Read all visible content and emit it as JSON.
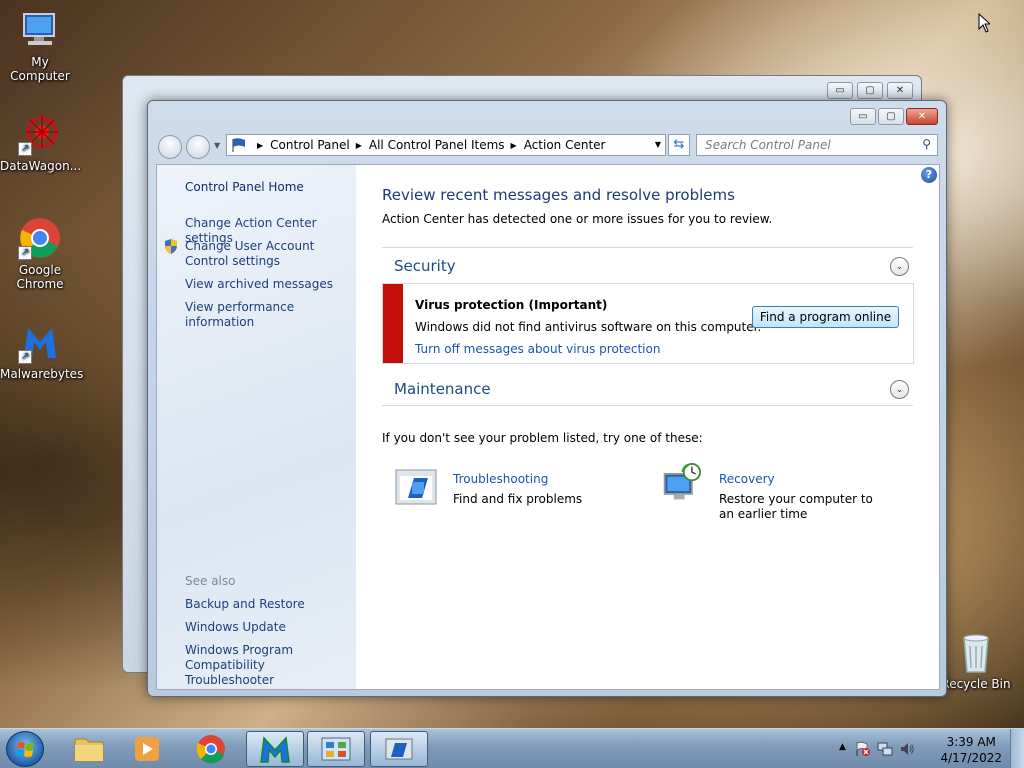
{
  "desktop": {
    "icons": [
      {
        "label": "My Computer"
      },
      {
        "label": "DataWagon..."
      },
      {
        "label": "Google\nChrome"
      },
      {
        "label": "Malwarebytes"
      },
      {
        "label": "Recycle Bin"
      }
    ]
  },
  "window": {
    "breadcrumb": [
      "Control Panel",
      "All Control Panel Items",
      "Action Center"
    ],
    "search_placeholder": "Search Control Panel",
    "caption": {
      "minimize": "▭",
      "maximize": "▢",
      "close": "✕"
    }
  },
  "sidebar": {
    "home": "Control Panel Home",
    "links": [
      "Change Action Center settings",
      "Change User Account Control settings",
      "View archived messages",
      "View performance information"
    ],
    "see_also_label": "See also",
    "see_also": [
      "Backup and Restore",
      "Windows Update",
      "Windows Program Compatibility Troubleshooter"
    ]
  },
  "main": {
    "title": "Review recent messages and resolve problems",
    "subtitle": "Action Center has detected one or more issues for you to review.",
    "security_label": "Security",
    "maintenance_label": "Maintenance",
    "alert": {
      "title": "Virus protection  (Important)",
      "description": "Windows did not find antivirus software on this computer.",
      "link": "Turn off messages about virus protection",
      "button": "Find a program online",
      "accent_color": "#c40d0d"
    },
    "hint": "If you don't see your problem listed, try one of these:",
    "options": [
      {
        "title": "Troubleshooting",
        "description": "Find and fix problems"
      },
      {
        "title": "Recovery",
        "description": "Restore your computer to an earlier time"
      }
    ]
  },
  "taskbar": {
    "time": "3:39 AM",
    "date": "4/17/2022"
  }
}
